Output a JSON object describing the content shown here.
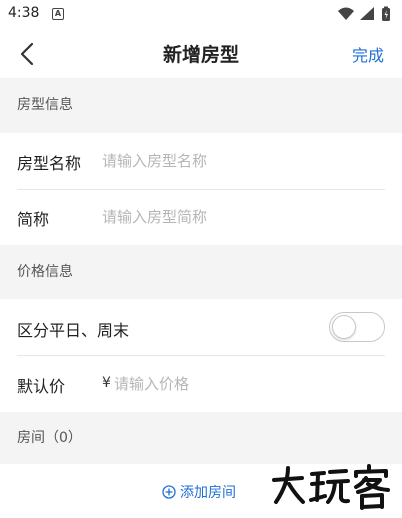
{
  "status_bar": {
    "time": "4:38",
    "notification_glyph": "A",
    "icons": [
      "wifi-icon",
      "signal-icon",
      "battery-icon"
    ]
  },
  "nav": {
    "back_icon": "chevron-left-icon",
    "title": "新增房型",
    "done_label": "完成"
  },
  "sections": {
    "room_type_info": "房型信息",
    "price_info": "价格信息",
    "rooms": "房间（0）"
  },
  "fields": {
    "room_type_name": {
      "label": "房型名称",
      "placeholder": "请输入房型名称",
      "value": ""
    },
    "short_name": {
      "label": "简称",
      "placeholder": "请输入房型简称",
      "value": ""
    },
    "weekend_split": {
      "label": "区分平日、周末",
      "enabled": false
    },
    "default_price": {
      "label": "默认价",
      "currency": "¥",
      "placeholder": "请输入价格",
      "value": ""
    }
  },
  "add_room": {
    "icon": "plus-circle-icon",
    "label": "添加房间"
  },
  "watermark": {
    "text": "大玩客"
  },
  "colors": {
    "accent": "#1f6fd6",
    "section_bg": "#f4f4f4",
    "placeholder": "#b6b6b6"
  }
}
